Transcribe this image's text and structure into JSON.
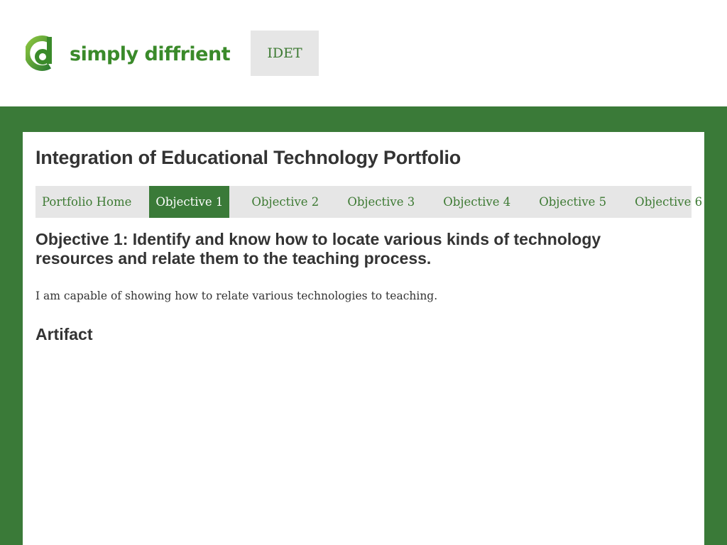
{
  "header": {
    "brand_name": "simply diffrient",
    "logo_icon": "d-letter-logo-icon",
    "tab_label": "IDET"
  },
  "main": {
    "site_title": "Integration of Educational Technology Portfolio",
    "nav": {
      "items": [
        {
          "label": "Portfolio Home",
          "active": false
        },
        {
          "label": "Objective 1",
          "active": true
        },
        {
          "label": "Objective 2",
          "active": false
        },
        {
          "label": "Objective 3",
          "active": false
        },
        {
          "label": "Objective 4",
          "active": false
        },
        {
          "label": "Objective 5",
          "active": false
        },
        {
          "label": "Objective 6",
          "active": false
        }
      ]
    },
    "objective_heading": "Objective 1: Identify and know how to locate various kinds of technology resources and relate them to the teaching process.",
    "objective_text": "I am capable of showing how to relate various technologies to teaching.",
    "artifact_heading": "Artifact"
  },
  "colors": {
    "brand_green": "#3a8a2a",
    "band_green": "#3a7a38",
    "nav_background": "#e6e6e6",
    "text_dark": "#333333"
  }
}
